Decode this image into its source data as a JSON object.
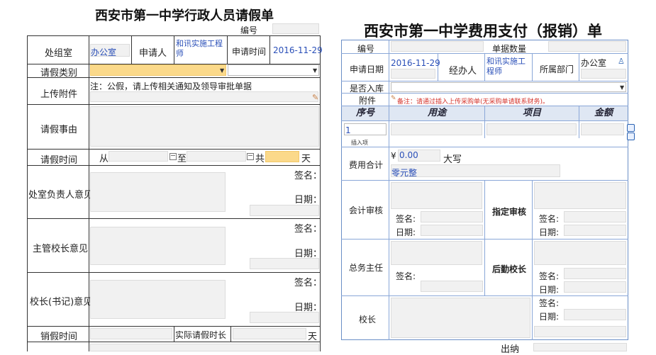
{
  "left_form": {
    "title": "西安市第一中学行政人员请假单",
    "number_label": "编号",
    "dept_label": "处组室",
    "dept_value": "办公室",
    "applicant_label": "申请人",
    "applicant_value": "和讯实施工程师",
    "apply_time_label": "申请时间",
    "apply_time_value": "2016-11-29",
    "leave_type_label": "请假类别",
    "attachment_label": "上传附件",
    "attachment_note": "注：公假，请上传相关通知及领导审批单据",
    "reason_label": "请假事由",
    "leave_time_label": "请假时间",
    "from_label": "从",
    "to_label": "至",
    "total_label": "共",
    "day_unit": "天",
    "dept_head_label": "处室负责人意见",
    "supervisor_label": "主管校长意见",
    "principal_label": "校长(书记)意见",
    "sign_label": "签名：",
    "date_label": "日期：",
    "cancel_time_label": "销假时间",
    "actual_days_label": "实际请假时长",
    "actual_day_unit": "天"
  },
  "right_form": {
    "title": "西安市第一中学费用支付（报销）单",
    "number_label": "编号",
    "doc_count_label": "单据数量",
    "apply_date_label": "申请日期",
    "apply_date_value": "2016-11-29",
    "handler_label": "经办人",
    "handler_value": "和讯实施工程师",
    "dept_label": "所属部门",
    "dept_value": "办公室",
    "warehouse_label": "是否入库",
    "attachment_label": "附件",
    "attachment_note": "备注：请通过插入上传采购单(无采购单请联系财务)。",
    "col_no": "序号",
    "col_purpose": "用途",
    "col_item": "项目",
    "col_amount": "金额",
    "row1_no": "1",
    "insert_label": "插入项",
    "total_label": "费用合计",
    "currency": "¥",
    "amount": "0.00",
    "capital_label": "大写",
    "capital_value": "零元整",
    "accounting_label": "会计审核",
    "designated_label": "指定审核",
    "general_label": "总务主任",
    "logistics_label": "后勤校长",
    "principal_label": "校长",
    "sign_label": "签名:",
    "date_label": "日期:",
    "footer_label": "出纳"
  },
  "colors": {
    "accent_blue": "#2a4fb8",
    "highlight_yellow": "#fbd98a",
    "header_blue": "#dfe7f3",
    "note_red": "#d4332b"
  }
}
